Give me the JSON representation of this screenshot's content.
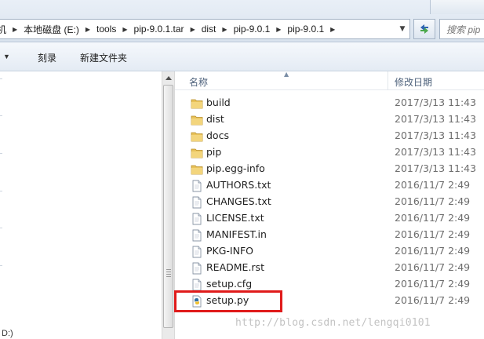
{
  "address_bar": {
    "crumbs": [
      "本地磁盘 (E:)",
      "tools",
      "pip-9.0.1.tar",
      "dist",
      "pip-9.0.1",
      "pip-9.0.1"
    ],
    "lead_glyph": "机",
    "search_placeholder": "搜索 pip"
  },
  "toolbar": {
    "burn_label": "刻录",
    "new_folder_label": "新建文件夹"
  },
  "nav": {
    "drive_label": "D:)"
  },
  "columns": {
    "name": "名称",
    "date_modified": "修改日期"
  },
  "files": [
    {
      "name": "build",
      "date": "2017/3/13 11:43",
      "type": "folder"
    },
    {
      "name": "dist",
      "date": "2017/3/13 11:43",
      "type": "folder"
    },
    {
      "name": "docs",
      "date": "2017/3/13 11:43",
      "type": "folder"
    },
    {
      "name": "pip",
      "date": "2017/3/13 11:43",
      "type": "folder"
    },
    {
      "name": "pip.egg-info",
      "date": "2017/3/13 11:43",
      "type": "folder"
    },
    {
      "name": "AUTHORS.txt",
      "date": "2016/11/7 2:49",
      "type": "file"
    },
    {
      "name": "CHANGES.txt",
      "date": "2016/11/7 2:49",
      "type": "file"
    },
    {
      "name": "LICENSE.txt",
      "date": "2016/11/7 2:49",
      "type": "file"
    },
    {
      "name": "MANIFEST.in",
      "date": "2016/11/7 2:49",
      "type": "file"
    },
    {
      "name": "PKG-INFO",
      "date": "2016/11/7 2:49",
      "type": "file"
    },
    {
      "name": "README.rst",
      "date": "2016/11/7 2:49",
      "type": "file"
    },
    {
      "name": "setup.cfg",
      "date": "2016/11/7 2:49",
      "type": "file"
    },
    {
      "name": "setup.py",
      "date": "2016/11/7 2:49",
      "type": "python"
    }
  ],
  "highlighted_file": "setup.py",
  "watermark": "http://blog.csdn.net/lengqi0101",
  "colors": {
    "folder": "#e8c25a",
    "highlight": "#e01b1b",
    "header_text": "#4c607a"
  }
}
